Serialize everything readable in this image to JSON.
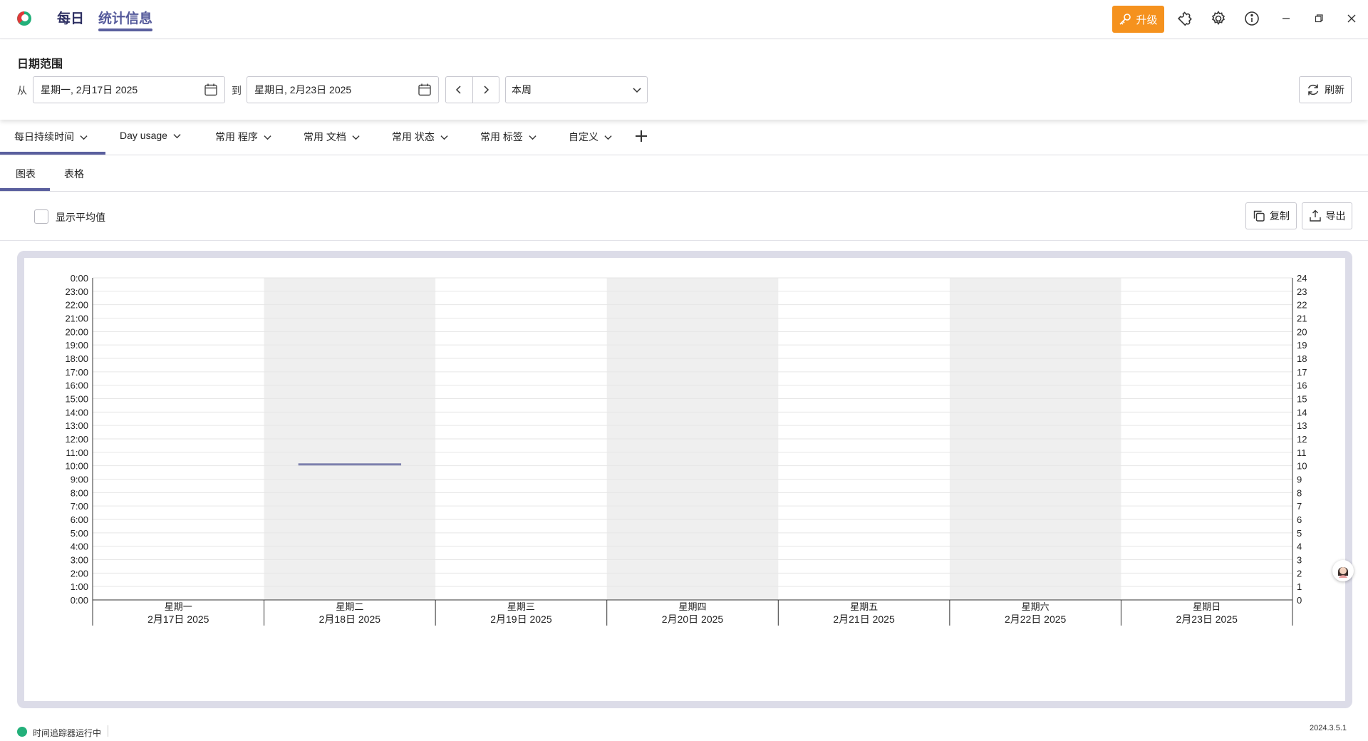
{
  "header": {
    "tabs": [
      {
        "label": "每日",
        "active": false
      },
      {
        "label": "统计信息",
        "active": true
      }
    ],
    "upgrade_label": "升级",
    "brand_colors": {
      "accent": "#5a5f9e",
      "upgrade": "#f5921e",
      "status_ok": "#23b07a"
    },
    "icons": [
      "puzzle-icon",
      "gear-icon",
      "info-icon",
      "minimize-icon",
      "restore-icon",
      "close-icon"
    ]
  },
  "date_range": {
    "title": "日期范围",
    "from_label": "从",
    "from_value": "星期一, 2月17日 2025",
    "to_label": "到",
    "to_value": "星期日, 2月23日 2025",
    "preset": "本周",
    "refresh_label": "刷新"
  },
  "report_tabs": [
    {
      "label": "每日持续时间",
      "active": true
    },
    {
      "label": "Day usage"
    },
    {
      "label": "常用 程序"
    },
    {
      "label": "常用 文档"
    },
    {
      "label": "常用 状态"
    },
    {
      "label": "常用 标签"
    },
    {
      "label": "自定义"
    }
  ],
  "view_tabs": [
    {
      "label": "图表",
      "active": true
    },
    {
      "label": "表格"
    }
  ],
  "options": {
    "show_average_label": "显示平均值",
    "show_average_checked": false,
    "copy_label": "复制",
    "export_label": "导出"
  },
  "chart_data": {
    "type": "bar",
    "categories": [
      {
        "day": "星期一",
        "date": "2月17日 2025"
      },
      {
        "day": "星期二",
        "date": "2月18日 2025"
      },
      {
        "day": "星期三",
        "date": "2月19日 2025"
      },
      {
        "day": "星期四",
        "date": "2月20日 2025"
      },
      {
        "day": "星期五",
        "date": "2月21日 2025"
      },
      {
        "day": "星期六",
        "date": "2月22日 2025"
      },
      {
        "day": "星期日",
        "date": "2月23日 2025"
      }
    ],
    "left_ticks": [
      "0:00",
      "1:00",
      "2:00",
      "3:00",
      "4:00",
      "5:00",
      "6:00",
      "7:00",
      "8:00",
      "9:00",
      "10:00",
      "11:00",
      "12:00",
      "13:00",
      "14:00",
      "15:00",
      "16:00",
      "17:00",
      "18:00",
      "19:00",
      "20:00",
      "21:00",
      "22:00",
      "23:00",
      "0:00"
    ],
    "right_ticks": [
      "0",
      "1",
      "2",
      "3",
      "4",
      "5",
      "6",
      "7",
      "8",
      "9",
      "10",
      "11",
      "12",
      "13",
      "14",
      "15",
      "16",
      "17",
      "18",
      "19",
      "20",
      "21",
      "22",
      "23",
      "24"
    ],
    "ylim": [
      0,
      24
    ],
    "series": [
      {
        "values": [
          0,
          10.1,
          0,
          0,
          0,
          0,
          0
        ]
      }
    ],
    "alternate_shading": true,
    "grid": true
  },
  "status": {
    "text": "时间追踪器运行中",
    "version": "2024.3.5.1"
  }
}
